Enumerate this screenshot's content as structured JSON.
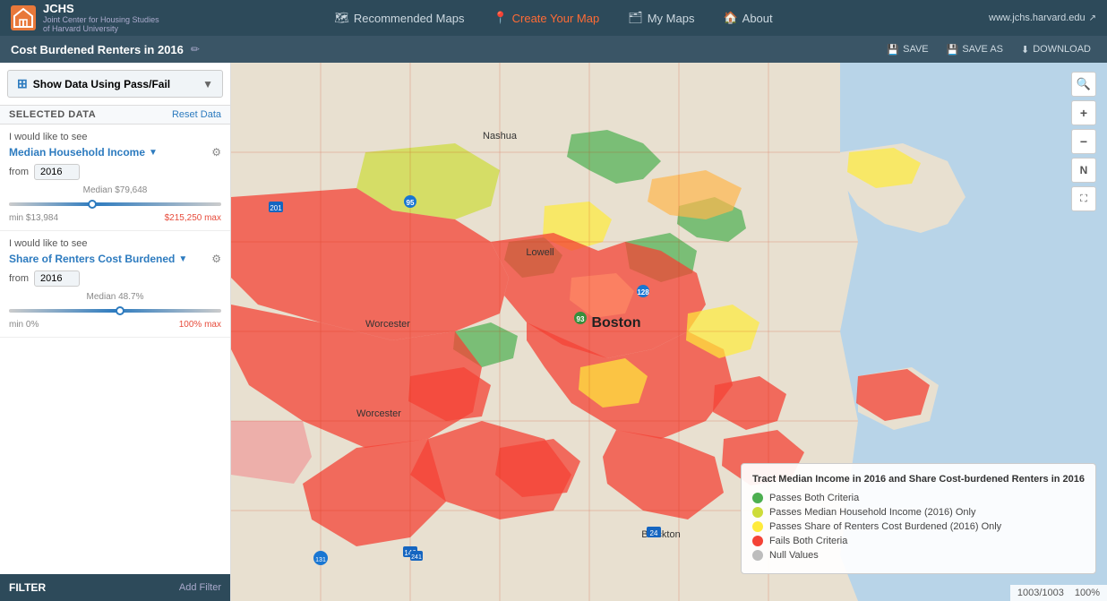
{
  "nav": {
    "logo_abbr": "JCHS",
    "logo_full": "Joint Center for Housing Studies of Harvard University",
    "links": [
      {
        "id": "recommended-maps",
        "label": "Recommended Maps",
        "icon": "🗺",
        "active": false
      },
      {
        "id": "create-your-map",
        "label": "Create Your Map",
        "icon": "📍",
        "active": true
      },
      {
        "id": "my-maps",
        "label": "My Maps",
        "icon": "🗂",
        "active": false
      },
      {
        "id": "about",
        "label": "About",
        "icon": "🏠",
        "active": false
      }
    ],
    "website": "www.jchs.harvard.edu"
  },
  "title_bar": {
    "map_title": "Cost Burdened Renters in 2016",
    "save_label": "SAVE",
    "save_as_label": "SAVE AS",
    "download_label": "DOWNLOAD"
  },
  "panel": {
    "show_data_label": "Show Data Using Pass/Fail",
    "selected_data_label": "SELECTED DATA",
    "reset_data_label": "Reset Data",
    "criteria1": {
      "prompt": "I would like to see",
      "field_name": "Median Household Income",
      "from_label": "from",
      "year": "2016",
      "median_label": "Median $79,648",
      "min_label": "min $13,984",
      "max_label": "$215,250 max"
    },
    "criteria2": {
      "prompt": "I would like to see",
      "field_name": "Share of Renters Cost Burdened",
      "from_label": "from",
      "year": "2016",
      "median_label": "Median 48.7%",
      "min_label": "min 0%",
      "max_label": "100% max"
    },
    "filter_label": "FILTER",
    "add_filter_label": "Add Filter"
  },
  "legend": {
    "title": "Tract Median Income in 2016 and Share Cost-burdened Renters in 2016",
    "items": [
      {
        "id": "passes-both",
        "color": "#4caf50",
        "label": "Passes Both Criteria"
      },
      {
        "id": "passes-income",
        "color": "#cddc39",
        "label": "Passes Median Household Income (2016) Only"
      },
      {
        "id": "passes-renters",
        "color": "#ffeb3b",
        "label": "Passes Share of Renters Cost Burdened (2016) Only"
      },
      {
        "id": "fails-both",
        "color": "#f44336",
        "label": "Fails Both Criteria"
      },
      {
        "id": "null-values",
        "color": "#bdbdbd",
        "label": "Null Values"
      }
    ]
  },
  "status": {
    "count": "1003/1003",
    "percent": "100%"
  },
  "map_controls": {
    "zoom_in": "+",
    "zoom_out": "−",
    "reset_north": "↑"
  }
}
